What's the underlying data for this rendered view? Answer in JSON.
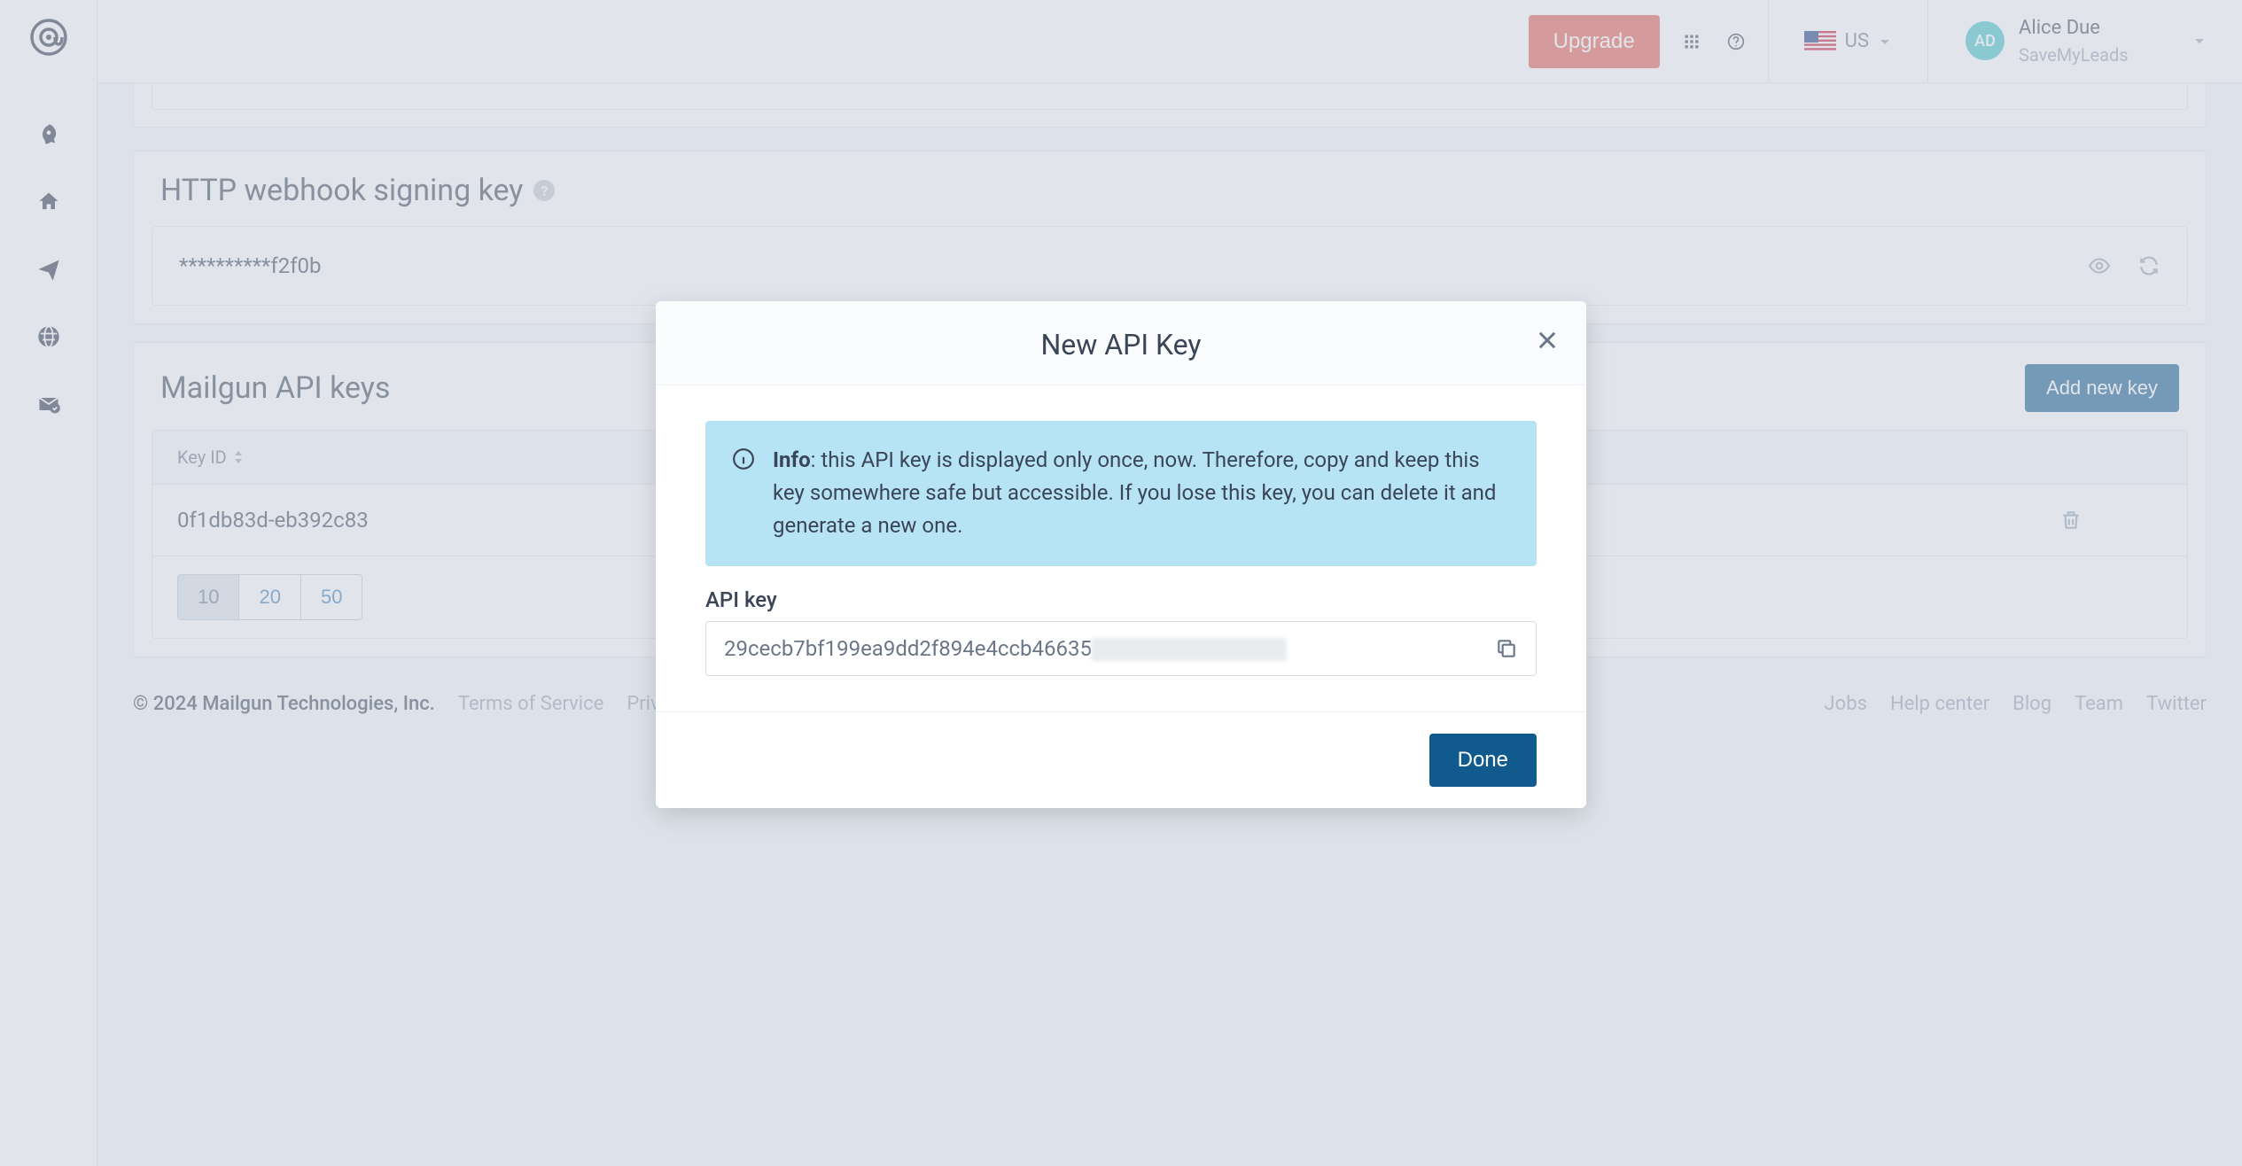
{
  "topbar": {
    "upgrade_label": "Upgrade",
    "region_label": "US",
    "user_initials": "AD",
    "user_name": "Alice Due",
    "user_sub": "SaveMyLeads"
  },
  "webhook_panel": {
    "title": "HTTP webhook signing key",
    "masked_key": "**********f2f0b"
  },
  "api_keys_panel": {
    "title": "Mailgun API keys",
    "add_label": "Add new key",
    "column_label": "Key ID",
    "rows": [
      {
        "key_id": "0f1db83d-eb392c83"
      }
    ],
    "pager": [
      "10",
      "20",
      "50"
    ],
    "pager_active": "10"
  },
  "footer": {
    "copyright": "© 2024 Mailgun Technologies, Inc.",
    "links_left": [
      "Terms of Service",
      "Privacy Policy"
    ],
    "links_right": [
      "Jobs",
      "Help center",
      "Blog",
      "Team",
      "Twitter"
    ]
  },
  "modal": {
    "title": "New API Key",
    "info_bold": "Info",
    "info_text": ": this API key is displayed only once, now. Therefore, copy and keep this key somewhere safe but accessible. If you lose this key, you can delete it and generate a new one.",
    "field_label": "API key",
    "api_key_visible": "29cecb7bf199ea9dd2f894e4ccb46635",
    "done_label": "Done"
  }
}
